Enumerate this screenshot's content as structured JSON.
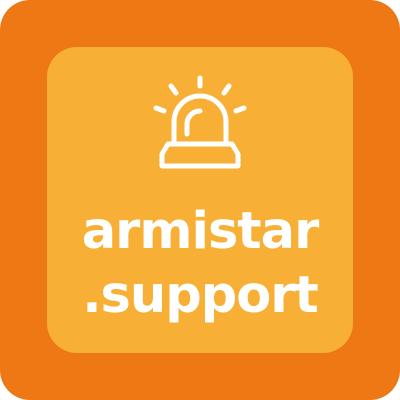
{
  "logo": {
    "icon": "alarm-siren-icon",
    "line1": "armistar",
    "line2": ".support",
    "colors": {
      "outer": "#ee7813",
      "inner": "#f8af36",
      "text": "#ffffff"
    }
  }
}
